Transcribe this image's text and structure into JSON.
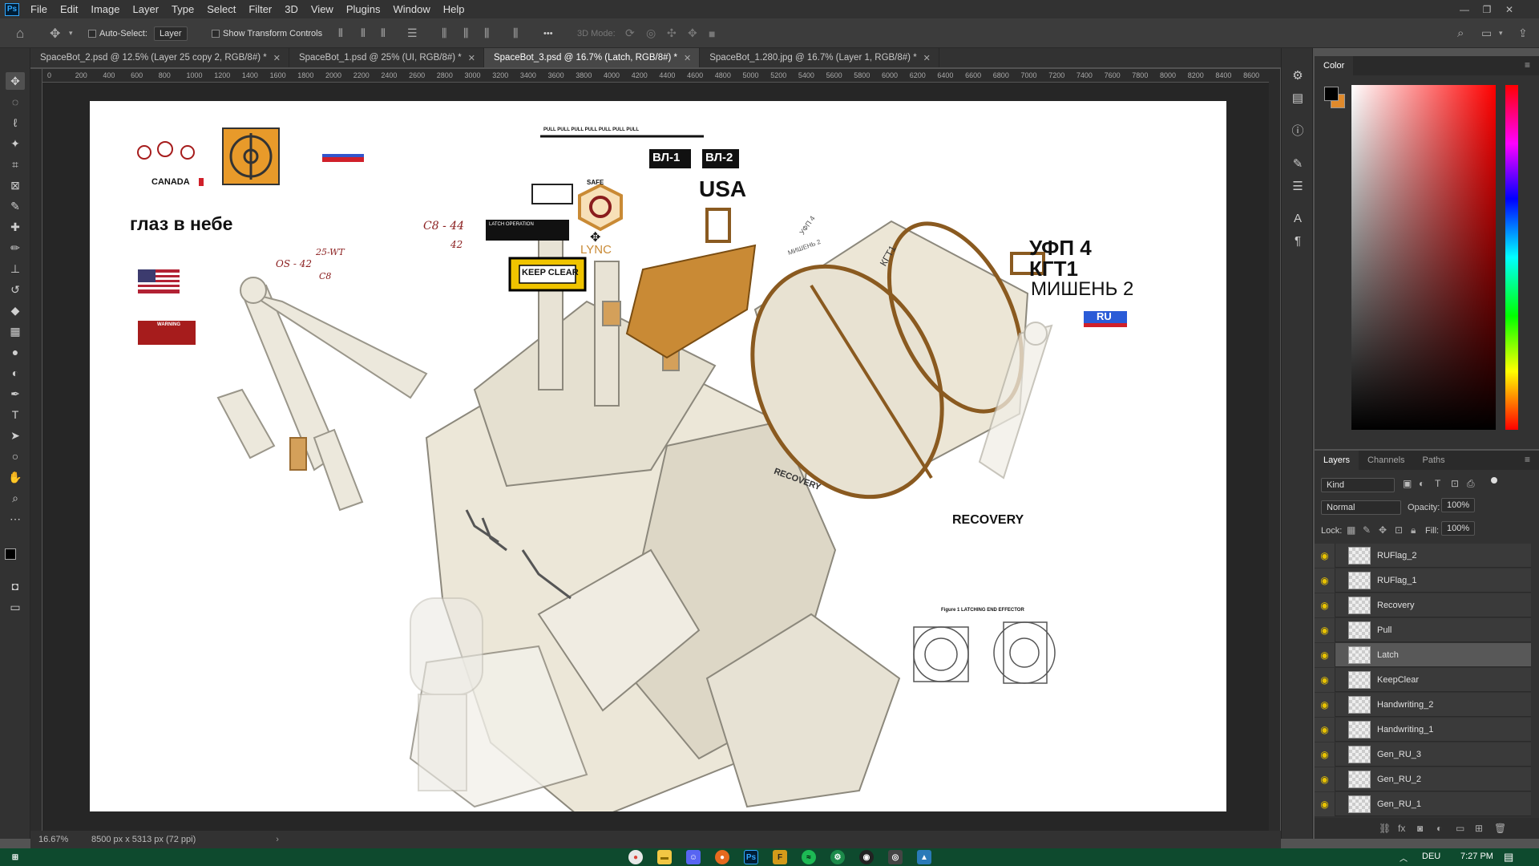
{
  "app": {
    "logo": "Ps"
  },
  "menu": [
    "File",
    "Edit",
    "Image",
    "Layer",
    "Type",
    "Select",
    "Filter",
    "3D",
    "View",
    "Plugins",
    "Window",
    "Help"
  ],
  "options": {
    "auto_select_label": "Auto-Select:",
    "auto_select_value": "Layer",
    "show_transform_label": "Show Transform Controls",
    "mode_3d_label": "3D Mode:",
    "more_label": "•••"
  },
  "tabs": [
    {
      "label": "SpaceBot_2.psd @ 12.5% (Layer 25 copy 2, RGB/8#) *",
      "active": false
    },
    {
      "label": "SpaceBot_1.psd @ 25% (UI, RGB/8#) *",
      "active": false
    },
    {
      "label": "SpaceBot_3.psd @ 16.7% (Latch, RGB/8#) *",
      "active": true
    },
    {
      "label": "SpaceBot_1.280.jpg @ 16.7% (Layer 1, RGB/8#) *",
      "active": false
    }
  ],
  "ruler": [
    "0",
    "200",
    "400",
    "600",
    "800",
    "1000",
    "1200",
    "1400",
    "1600",
    "1800",
    "2000",
    "2200",
    "2400",
    "2600",
    "2800",
    "3000",
    "3200",
    "3400",
    "3600",
    "3800",
    "4000",
    "4200",
    "4400",
    "4600",
    "4800",
    "5000",
    "5200",
    "5400",
    "5600",
    "5800",
    "6000",
    "6200",
    "6400",
    "6600",
    "6800",
    "7000",
    "7200",
    "7400",
    "7600",
    "7800",
    "8000",
    "8200",
    "8400",
    "8600"
  ],
  "canvas_text": {
    "canada": "CANADA",
    "glaz": "глаз в небе",
    "vl1": "ВЛ-1",
    "vl2": "ВЛ-2",
    "usa": "USA",
    "ufp": "УФП 4",
    "kgt": "КГТ1",
    "mishen": "МИШЕНЬ 2",
    "ru": "RU",
    "recovery": "RECOVERY",
    "recovery_small": "RECOVERY",
    "keep_clear": "KEEP CLEAR",
    "lync": "LYNC",
    "safe": "SAFE",
    "latch_op": "LATCH OPERATION",
    "pull_strip": "PULL PULL PULL PULL PULL PULL PULL",
    "hw1": "C8 - 44",
    "hw1b": "42",
    "hw2": "OS - 42",
    "hw2b": "25-WT",
    "hw2c": "C8",
    "figure_caption": "Figure 1 LATCHING END EFFECTOR",
    "warning": "WARNING",
    "kgt1_label": "КГТ1",
    "ufp_label": "УФП 4",
    "mishen_label": "МИШЕНЬ 2"
  },
  "status": {
    "zoom": "16.67%",
    "doc_info": "8500 px x 5313 px (72 ppi)"
  },
  "color_panel": {
    "title": "Color",
    "fg": "#000000",
    "bg": "#e08a2c"
  },
  "layers_panel": {
    "tabs": [
      "Layers",
      "Channels",
      "Paths"
    ],
    "filter": "Kind",
    "blend_mode": "Normal",
    "opacity_label": "Opacity:",
    "opacity": "100%",
    "lock_label": "Lock:",
    "fill_label": "Fill:",
    "fill": "100%",
    "layers": [
      {
        "name": "RUFlag_2",
        "selected": false
      },
      {
        "name": "RUFlag_1",
        "selected": false
      },
      {
        "name": "Recovery",
        "selected": false
      },
      {
        "name": "Pull",
        "selected": false
      },
      {
        "name": "Latch",
        "selected": true
      },
      {
        "name": "KeepClear",
        "selected": false
      },
      {
        "name": "Handwriting_2",
        "selected": false
      },
      {
        "name": "Handwriting_1",
        "selected": false
      },
      {
        "name": "Gen_RU_3",
        "selected": false
      },
      {
        "name": "Gen_RU_2",
        "selected": false
      },
      {
        "name": "Gen_RU_1",
        "selected": false
      }
    ]
  },
  "taskbar": {
    "lang": "DEU",
    "time": "7:27 PM"
  }
}
